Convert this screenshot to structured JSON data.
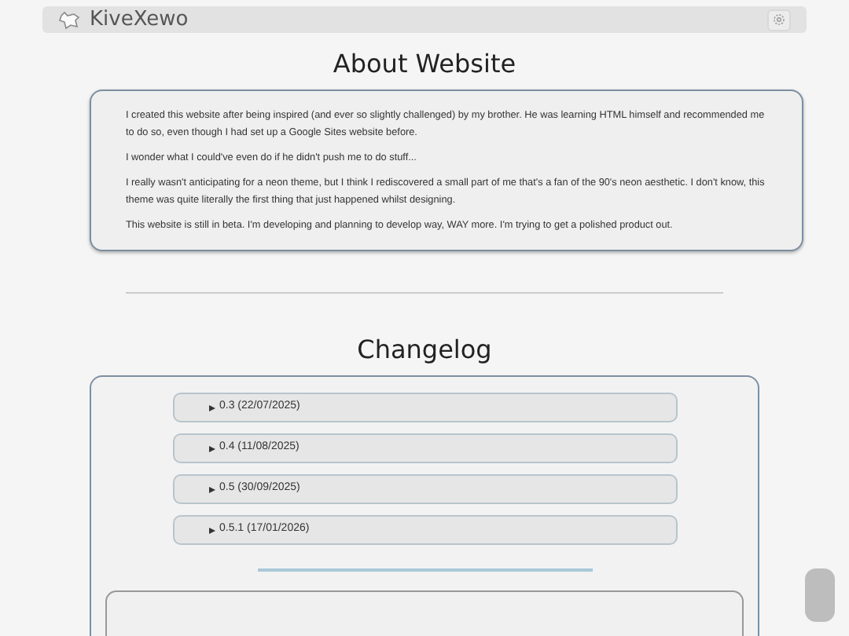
{
  "header": {
    "site_name": "KiveXewo"
  },
  "about": {
    "title": "About Website",
    "paragraphs": [
      "I created this website after being inspired (and ever so slightly challenged) by my brother. He was learning HTML himself and recommended me to do so, even though I had set up a Google Sites website before.",
      "I wonder what I could've even do if he didn't push me to do stuff...",
      "I really wasn't anticipating for a neon theme, but I think I rediscovered a small part of me that's a fan of the 90's neon aesthetic. I don't know, this theme was quite literally the first thing that just happened whilst designing.",
      "This website is still in beta. I'm developing and planning to develop way, WAY more. I'm trying to get a polished product out."
    ]
  },
  "changelog": {
    "title": "Changelog",
    "entries": [
      {
        "label": "0.3 (22/07/2025)",
        "expanded": false
      },
      {
        "label": "0.4 (11/08/2025)",
        "expanded": false
      },
      {
        "label": "0.5 (30/09/2025)",
        "expanded": false
      },
      {
        "label": "0.5.1 (17/01/2026)",
        "expanded": false
      }
    ]
  }
}
